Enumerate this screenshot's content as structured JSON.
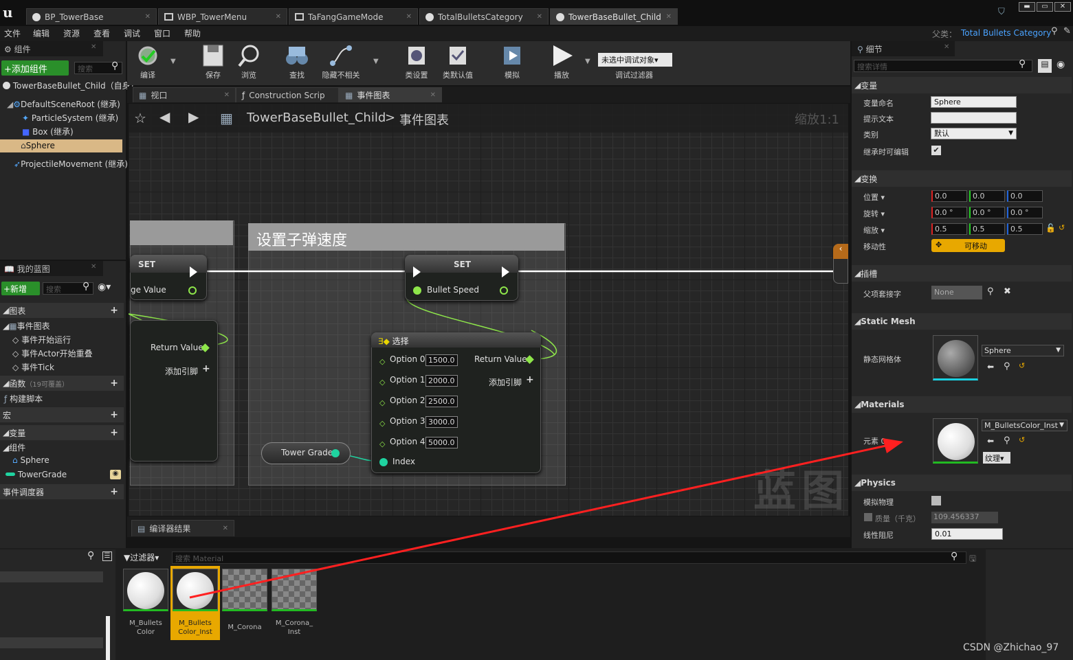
{
  "app": {
    "logo": "u"
  },
  "tabs": [
    {
      "label": "BP_TowerBase",
      "icon": "blueprint-icon"
    },
    {
      "label": "WBP_TowerMenu",
      "icon": "widget-icon"
    },
    {
      "label": "TaFangGameMode",
      "icon": "gamemode-icon"
    },
    {
      "label": "TotalBulletsCategory",
      "icon": "blueprint-icon"
    },
    {
      "label": "TowerBaseBullet_Child",
      "icon": "blueprint-icon"
    }
  ],
  "menu": [
    "文件",
    "编辑",
    "资源",
    "查看",
    "调试",
    "窗口",
    "帮助"
  ],
  "parent": {
    "label": "父类：",
    "value": "Total Bullets Category"
  },
  "components": {
    "title": "组件",
    "add_label": "+添加组件",
    "search_placeholder": "搜索",
    "root": "TowerBaseBullet_Child（自身）",
    "items": [
      "DefaultSceneRoot (继承)",
      "ParticleSystem (继承)",
      "Box (继承)",
      "Sphere",
      "ProjectileMovement (继承)"
    ]
  },
  "toolbar": [
    {
      "label": "编译"
    },
    {
      "label": "保存"
    },
    {
      "label": "浏览"
    },
    {
      "label": "查找"
    },
    {
      "label": "隐藏不相关"
    },
    {
      "label": "类设置"
    },
    {
      "label": "类默认值"
    },
    {
      "label": "模拟"
    },
    {
      "label": "播放"
    }
  ],
  "debug": {
    "selector": "未选中调试对象▾",
    "label": "调试过滤器"
  },
  "graph_tabs": [
    "视口",
    "Construction Scrip",
    "事件图表"
  ],
  "breadcrumb": {
    "root": "TowerBaseBullet_Child",
    "sep": ">",
    "current": "事件图表",
    "zoom": "缩放1:1"
  },
  "graph": {
    "comment_title": "设置子弹速度",
    "set_left": {
      "title": "SET",
      "pin": "ge Value"
    },
    "left_return": {
      "pin": "Return Value",
      "add": "添加引脚"
    },
    "set_node": {
      "title": "SET",
      "pin": "Bullet Speed"
    },
    "select_node": {
      "title": "选择",
      "options": [
        {
          "label": "Option 0",
          "value": "1500.0"
        },
        {
          "label": "Option 1",
          "value": "2000.0"
        },
        {
          "label": "Option 2",
          "value": "2500.0"
        },
        {
          "label": "Option 3",
          "value": "3000.0"
        },
        {
          "label": "Option 4",
          "value": "5000.0"
        }
      ],
      "return": "Return Value",
      "add": "添加引脚",
      "index": "Index"
    },
    "var_node": "Tower Grade",
    "watermark": "蓝图"
  },
  "my_blueprint": {
    "title": "我的蓝图",
    "new_label": "+新增",
    "search_placeholder": "搜索",
    "graphs": "图表",
    "event_graph": "事件图表",
    "events": [
      "事件开始运行",
      "事件Actor开始重叠",
      "事件Tick"
    ],
    "functions": "函数",
    "functions_note": "（19可覆盖）",
    "construction": "构建脚本",
    "macros": "宏",
    "variables": "变量",
    "component_group": "组件",
    "var_sphere": "Sphere",
    "var_tower": "TowerGrade",
    "dispatchers": "事件调度器"
  },
  "compiler": {
    "tab": "编译器结果"
  },
  "details": {
    "title": "细节",
    "search_placeholder": "搜索详情",
    "variable": {
      "section": "变量",
      "name_label": "变量命名",
      "name_value": "Sphere",
      "tooltip_label": "提示文本",
      "category_label": "类别",
      "category_value": "默认",
      "editable_label": "继承时可编辑"
    },
    "transform": {
      "section": "变换",
      "location": "位置",
      "rotation": "旋转",
      "scale": "缩放",
      "mobility": "移动性",
      "loc": [
        "0.0",
        "0.0",
        "0.0"
      ],
      "rot": [
        "0.0 °",
        "0.0 °",
        "0.0 °"
      ],
      "scl": [
        "0.5",
        "0.5",
        "0.5"
      ],
      "mobility_value": "可移动"
    },
    "sockets": {
      "section": "插槽",
      "parent_label": "父项套接字",
      "parent_value": "None"
    },
    "static_mesh": {
      "section": "Static Mesh",
      "label": "静态网格体",
      "value": "Sphere"
    },
    "materials": {
      "section": "Materials",
      "label": "元素 0",
      "value": "M_BulletsColor_Inst",
      "texture": "纹理▾"
    },
    "physics": {
      "section": "Physics",
      "simulate": "模拟物理",
      "mass": "质量（千克）",
      "mass_value": "109.456337",
      "damping": "线性阻尼",
      "damping_value": "0.01"
    }
  },
  "content_browser": {
    "filter": "过滤器",
    "search_placeholder": "搜索 Material",
    "assets": [
      {
        "name": "M_Bullets\nColor",
        "selected": false
      },
      {
        "name": "M_Bullets\nColor_Inst",
        "selected": true
      },
      {
        "name": "M_Corona",
        "selected": false
      },
      {
        "name": "M_Corona_\nInst",
        "selected": false
      }
    ]
  },
  "credit": "CSDN @Zhichao_97",
  "colors": {
    "accent": "#e8a800",
    "exec": "#ffffff",
    "float": "#8ee64a",
    "int": "#1fd3a0",
    "arrow": "#ff2020"
  }
}
